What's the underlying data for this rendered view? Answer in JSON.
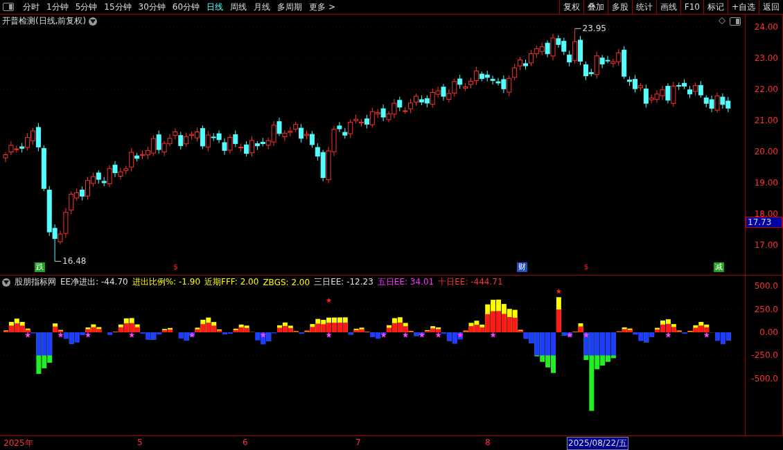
{
  "toolbar": {
    "periods": [
      {
        "label": "分时",
        "selected": false
      },
      {
        "label": "1分钟",
        "selected": false
      },
      {
        "label": "5分钟",
        "selected": false
      },
      {
        "label": "15分钟",
        "selected": false
      },
      {
        "label": "30分钟",
        "selected": false
      },
      {
        "label": "60分钟",
        "selected": false
      },
      {
        "label": "日线",
        "selected": true
      },
      {
        "label": "周线",
        "selected": false
      },
      {
        "label": "月线",
        "selected": false
      },
      {
        "label": "多周期",
        "selected": false
      },
      {
        "label": "更多 >",
        "selected": false
      }
    ],
    "buttons": [
      "复权",
      "叠加",
      "多股",
      "统计",
      "画线",
      "F10",
      "标记",
      "+自选",
      "返回"
    ]
  },
  "main_chart": {
    "title": "开普检测(日线,前复权)",
    "y_ticks": [
      "24.00",
      "23.00",
      "22.00",
      "21.00",
      "20.00",
      "19.00",
      "18.00",
      "17.00"
    ],
    "current_price": "17.73",
    "high_label": "23.95",
    "low_label": "16.48",
    "markers": [
      {
        "kind": "tag",
        "text": "跌",
        "color": "#1fa01f"
      },
      {
        "kind": "sign",
        "text": "$"
      },
      {
        "kind": "tag",
        "text": "财",
        "color": "#2050c0"
      },
      {
        "kind": "sign",
        "text": "$"
      },
      {
        "kind": "tag",
        "text": "减",
        "color": "#1fa01f"
      }
    ]
  },
  "indicator": {
    "name": "股朋指标网",
    "readouts": [
      {
        "label": "EE净进出:",
        "value": "-44.70",
        "color": "#e0e0e0"
      },
      {
        "label": "进出比例%:",
        "value": "-1.90",
        "color": "#ffff00"
      },
      {
        "label": "近期FFF:",
        "value": "2.00",
        "color": "#ffff00"
      },
      {
        "label": "ZBGS:",
        "value": "2.00",
        "color": "#ffff00"
      },
      {
        "label": "三日EE:",
        "value": "-12.23",
        "color": "#e0e0e0"
      },
      {
        "label": "五日EE:",
        "value": "34.01",
        "color": "#ff30ff"
      },
      {
        "label": "十日EE:",
        "value": "-444.71",
        "color": "#ff3030"
      }
    ],
    "y_ticks": [
      "500.0",
      "250.0",
      "0.00",
      "-250.0",
      "-500.0"
    ]
  },
  "date_axis": {
    "labels": [
      "2025年",
      "5",
      "6",
      "7",
      "8"
    ],
    "cursor_date": "2025/08/22/五"
  }
}
